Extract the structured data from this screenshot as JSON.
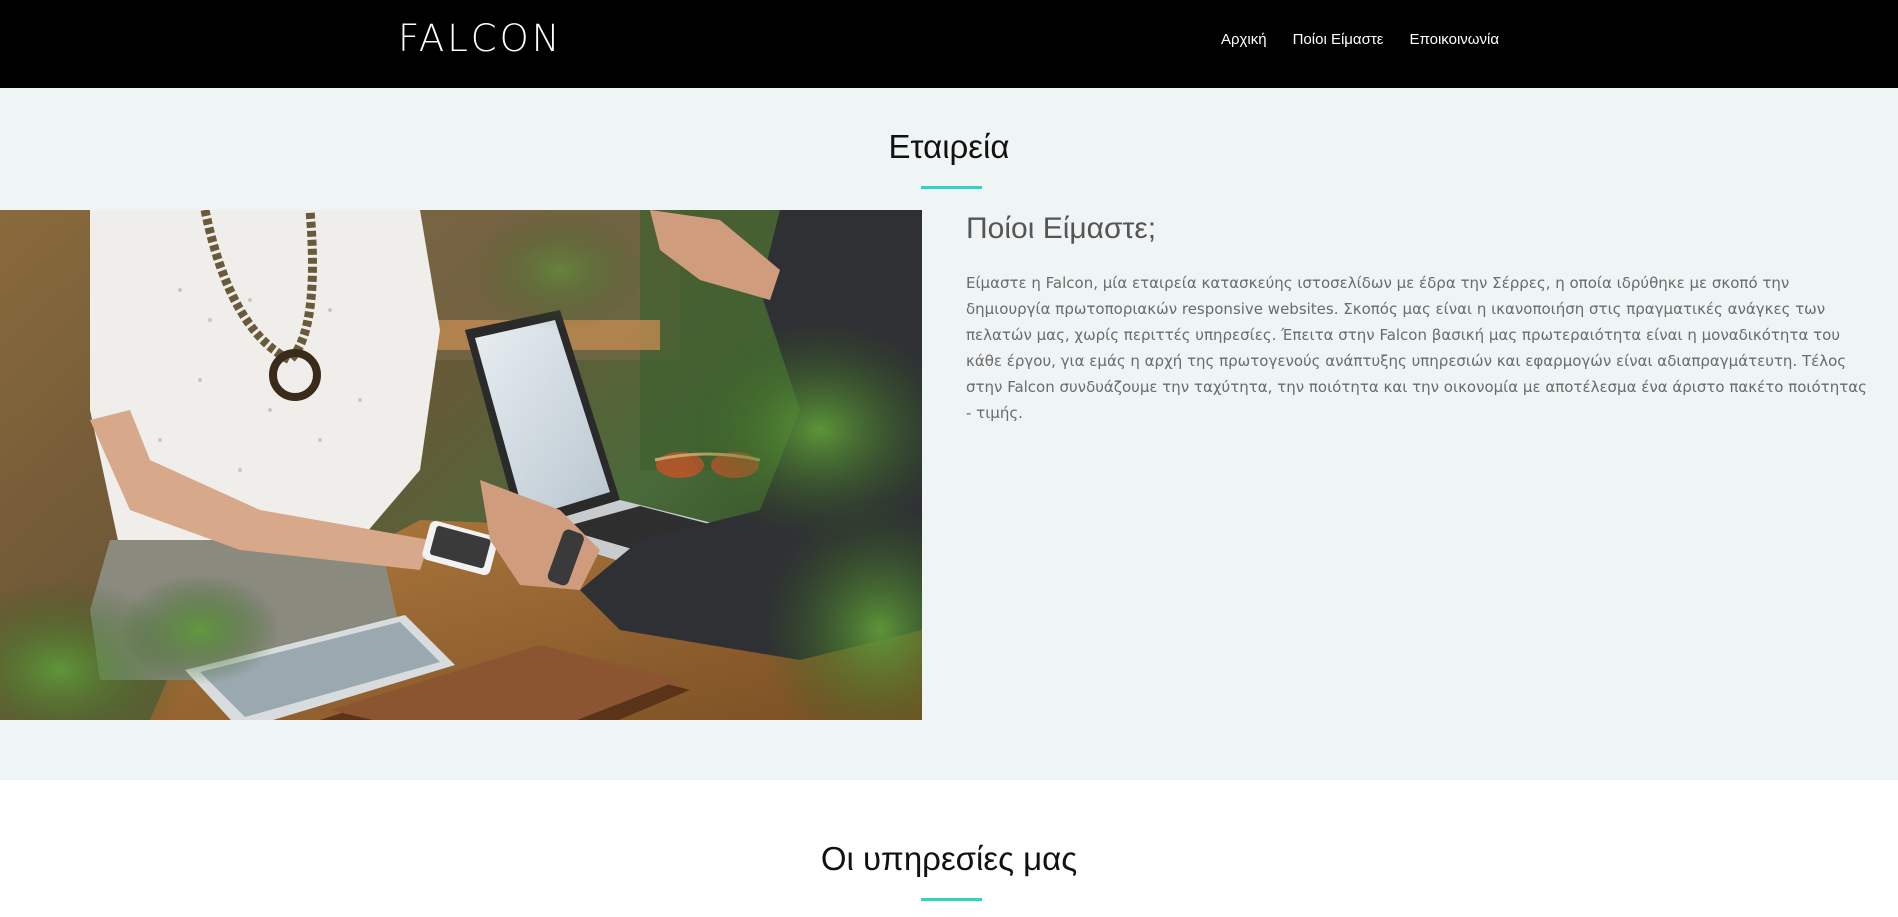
{
  "brand": {
    "logo_text": "FALCON"
  },
  "nav": {
    "items": [
      {
        "label": "Αρχική"
      },
      {
        "label": "Ποίοι Είμαστε"
      },
      {
        "label": "Εποικοινωνία"
      }
    ]
  },
  "about": {
    "section_title": "Εταιρεία",
    "heading": "Ποίοι Είμαστε;",
    "body": "Είμαστε η Falcon, μία εταιρεία κατασκεύης ιστοσελίδων με έδρα την Σέρρες, η οποία ιδρύθηκε με σκοπό την δημιουργία πρωτοποριακών responsive websites. Σκοπός μας είναι η ικανοποιήση στις πραγματικές ανάγκες των πελατών μας, χωρίς περιττές υπηρεσίες. Έπειτα στην Falcon βασική μας πρωτεραιότητα είναι η μοναδικότητα του κάθε έργου, για εμάς η αρχή της πρωτογενούς ανάπτυξης υπηρεσιών και εφαρμογών είναι αδιαπραγμάτευτη. Τέλος στην Falcon συνδυάζουμε την ταχύτητα, την ποιότητα και την οικονομία με αποτέλεσμα ένα άριστο πακέτο ποιότητας - τιμής."
  },
  "services": {
    "section_title": "Οι υπηρεσίες μας"
  },
  "colors": {
    "navbar_bg": "#000000",
    "section_bg": "#eff4f4",
    "accent": "#2fd5bf",
    "heading_text": "#555555",
    "body_text": "#6b6b6b"
  }
}
